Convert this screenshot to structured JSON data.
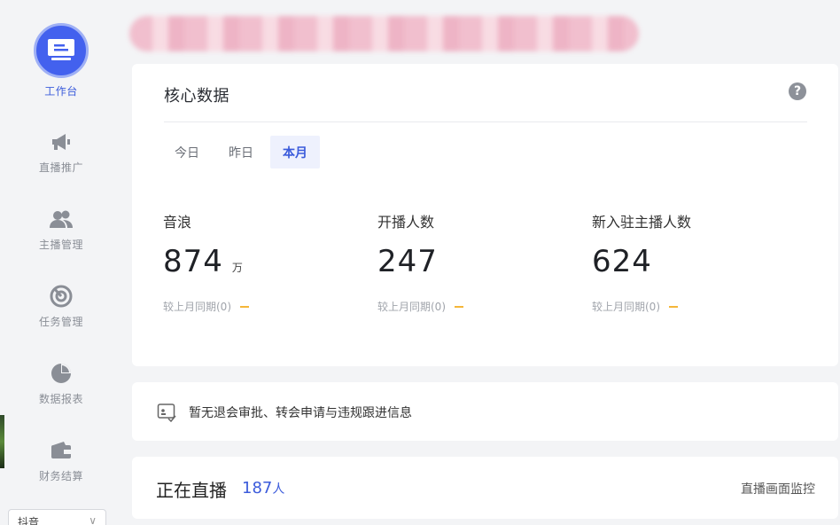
{
  "sidebar": {
    "items": [
      {
        "label": "工作台",
        "icon": "workbench-icon"
      },
      {
        "label": "直播推广",
        "icon": "megaphone-icon"
      },
      {
        "label": "主播管理",
        "icon": "users-icon"
      },
      {
        "label": "任务管理",
        "icon": "target-icon"
      },
      {
        "label": "数据报表",
        "icon": "pie-chart-icon"
      },
      {
        "label": "财务结算",
        "icon": "wallet-icon"
      }
    ],
    "platform": {
      "value": "抖音",
      "arrow": "∨"
    },
    "accent": "#4361ee"
  },
  "core": {
    "title": "核心数据",
    "help": "?",
    "tabs": [
      "今日",
      "昨日",
      "本月"
    ],
    "active_tab": "本月",
    "metrics": [
      {
        "label": "音浪",
        "value": "874",
        "unit": "万",
        "compare": "较上月同期(0)"
      },
      {
        "label": "开播人数",
        "value": "247",
        "unit": "",
        "compare": "较上月同期(0)"
      },
      {
        "label": "新入驻主播人数",
        "value": "624",
        "unit": "",
        "compare": "较上月同期(0)"
      }
    ]
  },
  "notice": {
    "text": "暂无退会审批、转会申请与违规跟进信息"
  },
  "live": {
    "title": "正在直播",
    "count": "187",
    "unit": "人",
    "link": "直播画面监控"
  }
}
